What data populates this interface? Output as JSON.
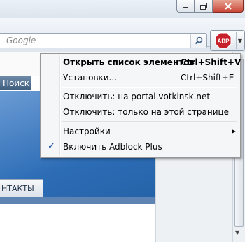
{
  "browser": {
    "search_placeholder": "Google",
    "page_search_button": "Поиск",
    "contacts_tab": "НТАКТЫ",
    "adblock_button_label": "ABP"
  },
  "menu": {
    "items": [
      {
        "label": "Открыть список элементов",
        "shortcut": "Ctrl+Shift+V",
        "bold": true
      },
      {
        "label": "Установки...",
        "shortcut": "Ctrl+Shift+E"
      },
      {
        "label": "Отключить: на portal.votkinsk.net"
      },
      {
        "label": "Отключить: только на этой странице"
      },
      {
        "label": "Настройки",
        "submenu": true
      },
      {
        "label": "Включить Adblock Plus",
        "checked": true
      }
    ]
  },
  "colors": {
    "abp_red": "#c8202a",
    "page_blue": "#2d6db6",
    "checkmark": "#1a55a8"
  },
  "icons": [
    "minimize-icon",
    "restore-icon",
    "close-icon",
    "search-icon",
    "adblock-plus-icon",
    "chevron-down-icon",
    "chevron-right-icon",
    "checkmark-icon",
    "chevron-down-scroll-icon"
  ]
}
